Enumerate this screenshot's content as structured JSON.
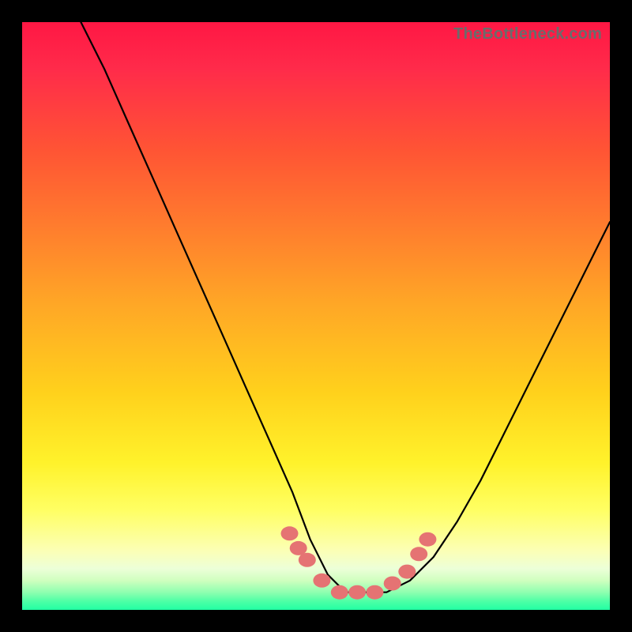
{
  "watermark": "TheBottleneck.com",
  "chart_data": {
    "type": "line",
    "title": "",
    "xlabel": "",
    "ylabel": "",
    "xlim": [
      0,
      100
    ],
    "ylim": [
      0,
      100
    ],
    "series": [
      {
        "name": "bottleneck-curve",
        "x": [
          10,
          14,
          18,
          22,
          26,
          30,
          34,
          38,
          42,
          46,
          49,
          52,
          55,
          58,
          62,
          66,
          70,
          74,
          78,
          82,
          86,
          90,
          94,
          98,
          100
        ],
        "values": [
          100,
          92,
          83,
          74,
          65,
          56,
          47,
          38,
          29,
          20,
          12,
          6,
          3,
          3,
          3,
          5,
          9,
          15,
          22,
          30,
          38,
          46,
          54,
          62,
          66
        ]
      }
    ],
    "markers": {
      "name": "highlight-dots",
      "color": "#e57373",
      "x": [
        45.5,
        47.0,
        48.5,
        51.0,
        54.0,
        57.0,
        60.0,
        63.0,
        65.5,
        67.5,
        69.0
      ],
      "values": [
        13.0,
        10.5,
        8.5,
        5.0,
        3.0,
        3.0,
        3.0,
        4.5,
        6.5,
        9.5,
        12.0
      ]
    },
    "legend": false,
    "grid": false
  }
}
